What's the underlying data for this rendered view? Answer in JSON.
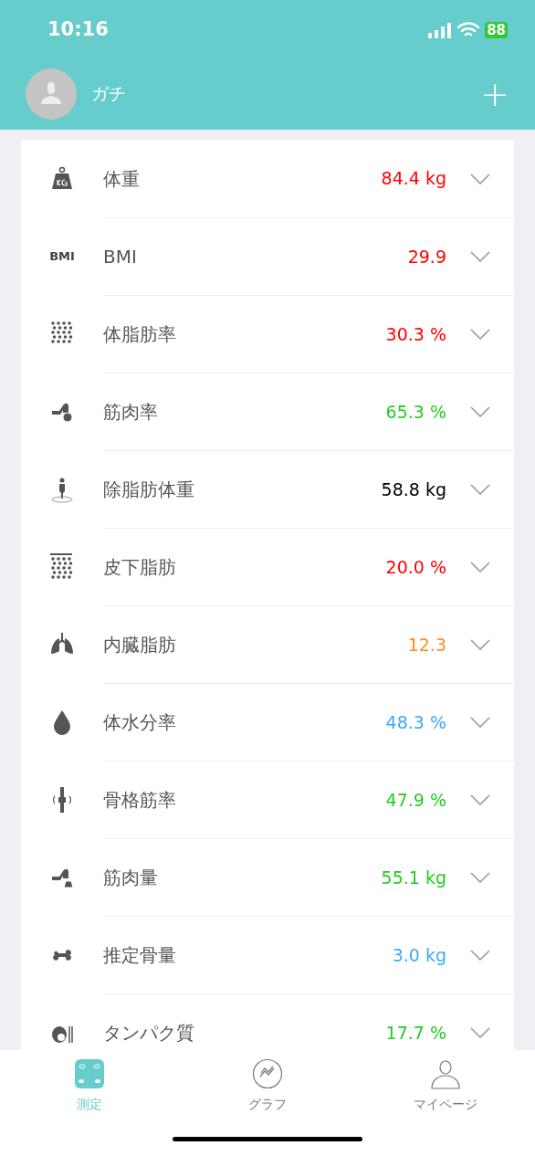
{
  "status_bar": {
    "time": "10:16",
    "battery": "88"
  },
  "header": {
    "user_name": "ガチ",
    "add_button": "+"
  },
  "metrics": [
    {
      "label": "体重",
      "value": "84.4 kg",
      "color": "#ff0000"
    },
    {
      "label": "BMI",
      "value": "29.9",
      "color": "#ff0000",
      "icon_text": "BMI"
    },
    {
      "label": "体脂肪率",
      "value": "30.3 %",
      "color": "#ff0000"
    },
    {
      "label": "筋肉率",
      "value": "65.3 %",
      "color": "#22cc22"
    },
    {
      "label": "除脂肪体重",
      "value": "58.8 kg",
      "color": "#000000"
    },
    {
      "label": "皮下脂肪",
      "value": "20.0 %",
      "color": "#ff0000"
    },
    {
      "label": "内臓脂肪",
      "value": "12.3",
      "color": "#ff8c1a"
    },
    {
      "label": "体水分率",
      "value": "48.3 %",
      "color": "#3daaf5"
    },
    {
      "label": "骨格筋率",
      "value": "47.9 %",
      "color": "#22cc22"
    },
    {
      "label": "筋肉量",
      "value": "55.1 kg",
      "color": "#22cc22"
    },
    {
      "label": "推定骨量",
      "value": "3.0 kg",
      "color": "#3daaf5"
    },
    {
      "label": "タンパク質",
      "value": "17.7 %",
      "color": "#22cc22"
    }
  ],
  "tabs": [
    {
      "label": "測定",
      "selected": true
    },
    {
      "label": "グラフ",
      "selected": false
    },
    {
      "label": "マイページ",
      "selected": false
    }
  ]
}
